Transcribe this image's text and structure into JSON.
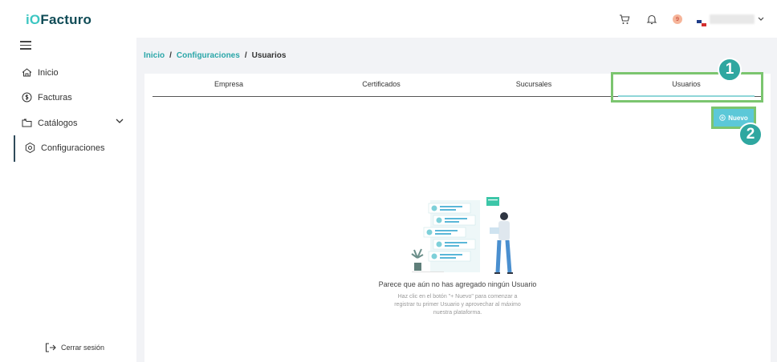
{
  "app": {
    "logo_prefix": "iO",
    "logo_name": "Facturo",
    "notification_count": "9"
  },
  "sidebar": {
    "items": [
      {
        "label": "Inicio",
        "icon": "home-icon"
      },
      {
        "label": "Facturas",
        "icon": "dollar-icon"
      },
      {
        "label": "Catálogos",
        "icon": "folder-icon"
      },
      {
        "label": "Configuraciones",
        "icon": "settings-icon"
      }
    ],
    "logout_label": "Cerrar sesión"
  },
  "breadcrumb": {
    "items": [
      "Inicio",
      "Configuraciones",
      "Usuarios"
    ],
    "separator": "/"
  },
  "tabs": [
    {
      "label": "Empresa",
      "active": false
    },
    {
      "label": "Certificados",
      "active": false
    },
    {
      "label": "Sucursales",
      "active": false
    },
    {
      "label": "Usuarios",
      "active": true
    }
  ],
  "actions": {
    "new_label": "Nuevo",
    "new_icon": "plus-circle-icon"
  },
  "annotations": {
    "badge1": "1",
    "badge2": "2",
    "highlight_color": "#7bc56f"
  },
  "empty_state": {
    "title": "Parece que aún no has agregado ningún Usuario",
    "description": "Haz clic en el botón \"+ Nuevo\" para comenzar a registrar tu primer Usuario y aprovechar al máximo nuestra plataforma."
  },
  "colors": {
    "accent": "#2aa6a8",
    "button": "#5cc8d8",
    "logo_dark": "#0f4b56"
  }
}
